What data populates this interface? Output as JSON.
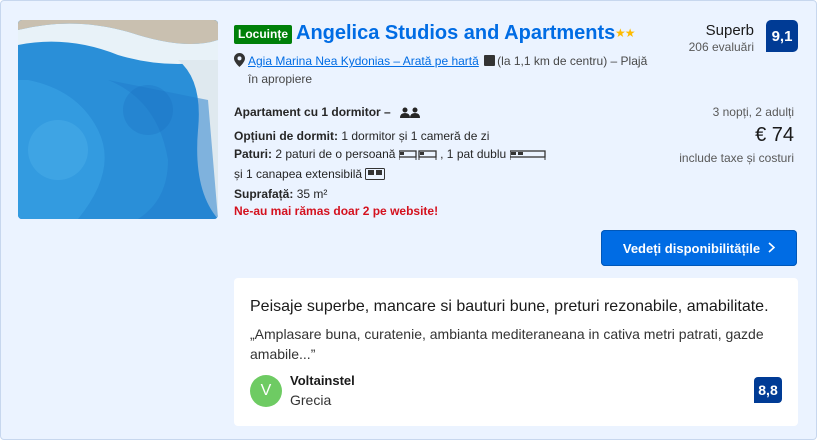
{
  "property": {
    "badge": "Locuințe",
    "name": "Angelica Studios and Apartments",
    "stars": "★★",
    "location_link": "Agia Marina Nea Kydonias – Arată pe hartă",
    "distance": "(la 1,1 km de centru)",
    "beach": "– Plajă în apropiere"
  },
  "rating": {
    "label": "Superb",
    "count": "206 evaluări",
    "score": "9,1"
  },
  "room": {
    "name": "Apartament cu 1 dormitor",
    "separator": "–",
    "sleep_label": "Opțiuni de dormit:",
    "sleep_value": "1 dormitor și 1 cameră de zi",
    "beds_label": "Paturi:",
    "beds_value_1": "2 paturi de o persoană",
    "beds_value_2": ", 1 pat dublu",
    "beds_value_3": "și 1 canapea extensibilă",
    "area_label": "Suprafață:",
    "area_value": "35 m²",
    "warning": "Ne-au mai rămas doar 2 pe website!"
  },
  "price": {
    "stay": "3 nopți, 2 adulți",
    "amount": "€ 74",
    "taxes": "include taxe și costuri"
  },
  "cta": {
    "label": "Vedeți disponibilitățile"
  },
  "review": {
    "title": "Peisaje superbe, mancare si bauturi bune, preturi rezonabile, amabilitate.",
    "text": "„Amplasare buna, curatenie, ambianta mediteraneana in cativa metri patrati, gazde amabile...”",
    "avatar_letter": "V",
    "author": "Voltainstel",
    "country": "Grecia",
    "score": "8,8"
  },
  "colors": {
    "primary": "#006ce4",
    "score_bg": "#003b95",
    "badge_green": "#008009",
    "warning_red": "#d4111e",
    "star_yellow": "#febb02",
    "card_bg": "#ebf3ff"
  }
}
